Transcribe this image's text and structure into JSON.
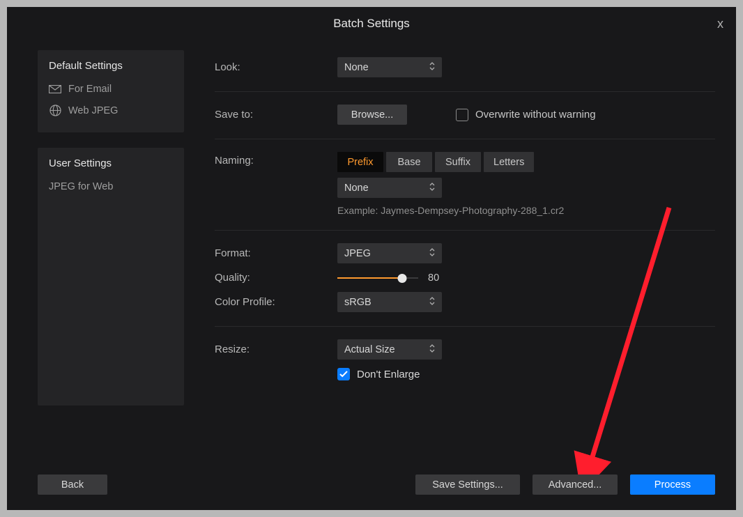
{
  "window": {
    "title": "Batch Settings",
    "close": "x"
  },
  "sidebar": {
    "default_header": "Default Settings",
    "default_items": [
      {
        "label": "For Email"
      },
      {
        "label": "Web JPEG"
      }
    ],
    "user_header": "User Settings",
    "user_items": [
      {
        "label": "JPEG for Web"
      }
    ]
  },
  "main": {
    "look_label": "Look:",
    "look_value": "None",
    "save_label": "Save to:",
    "browse_btn": "Browse...",
    "overwrite_cb": "Overwrite without warning",
    "naming_label": "Naming:",
    "naming_segments": [
      "Prefix",
      "Base",
      "Suffix",
      "Letters"
    ],
    "naming_active": "Prefix",
    "naming_value": "None",
    "naming_example_prefix": "Example: ",
    "naming_example": "Jaymes-Dempsey-Photography-288_1.cr2",
    "format_label": "Format:",
    "format_value": "JPEG",
    "quality_label": "Quality:",
    "quality_value": "80",
    "quality_percent": 80,
    "color_label": "Color Profile:",
    "color_value": "sRGB",
    "resize_label": "Resize:",
    "resize_value": "Actual Size",
    "dont_enlarge": "Don't Enlarge"
  },
  "footer": {
    "back": "Back",
    "save_settings": "Save Settings...",
    "advanced": "Advanced...",
    "process": "Process"
  }
}
